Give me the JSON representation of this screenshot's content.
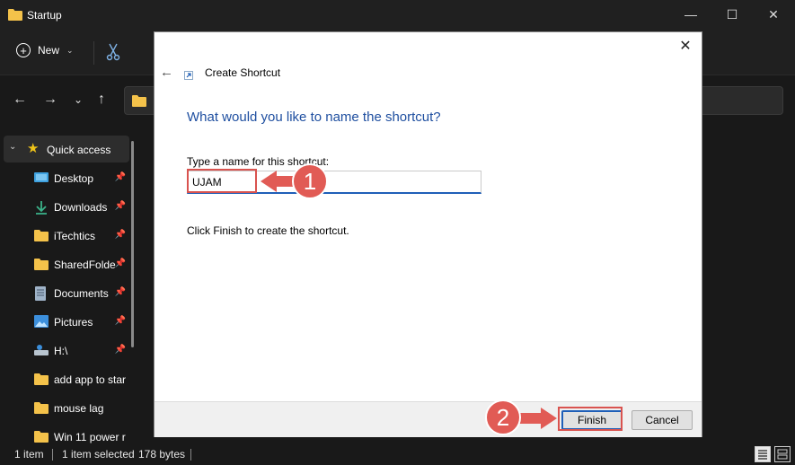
{
  "window": {
    "title": "Startup",
    "minimize_glyph": "—",
    "maximize_glyph": "☐",
    "close_glyph": "✕"
  },
  "toolbar": {
    "new_label": "New",
    "new_chevron": "⌄"
  },
  "nav": {
    "back": "←",
    "forward": "→",
    "recent": "⌄",
    "up": "↑"
  },
  "sidebar": {
    "items": [
      {
        "label": "Quick access",
        "icon": "star-icon",
        "pinned": false
      },
      {
        "label": "Desktop",
        "icon": "desktop-icon",
        "pinned": true
      },
      {
        "label": "Downloads",
        "icon": "download-icon",
        "pinned": true
      },
      {
        "label": "iTechtics",
        "icon": "folder-icon",
        "pinned": true
      },
      {
        "label": "SharedFolde",
        "icon": "folder-icon",
        "pinned": true
      },
      {
        "label": "Documents",
        "icon": "document-icon",
        "pinned": true
      },
      {
        "label": "Pictures",
        "icon": "pictures-icon",
        "pinned": true
      },
      {
        "label": "H:\\",
        "icon": "drive-icon",
        "pinned": true
      },
      {
        "label": "add app to star",
        "icon": "folder-icon",
        "pinned": false
      },
      {
        "label": "mouse lag",
        "icon": "folder-icon",
        "pinned": false
      },
      {
        "label": "Win 11 power r",
        "icon": "folder-icon",
        "pinned": false
      }
    ]
  },
  "status": {
    "item_count": "1 item",
    "selected": "1 item selected",
    "size": "178 bytes"
  },
  "dialog": {
    "title": "Create Shortcut",
    "heading": "What would you like to name the shortcut?",
    "name_label": "Type a name for this shortcut:",
    "name_value": "UJAM",
    "hint": "Click Finish to create the shortcut.",
    "finish_label": "Finish",
    "cancel_label": "Cancel",
    "close_glyph": "✕",
    "back_glyph": "←"
  },
  "annotations": {
    "step1": "1",
    "step2": "2"
  },
  "colors": {
    "accent": "#1f5fb8",
    "heading": "#1f4fa0",
    "annotation": "#e15b55",
    "folder": "#f4c24a"
  }
}
